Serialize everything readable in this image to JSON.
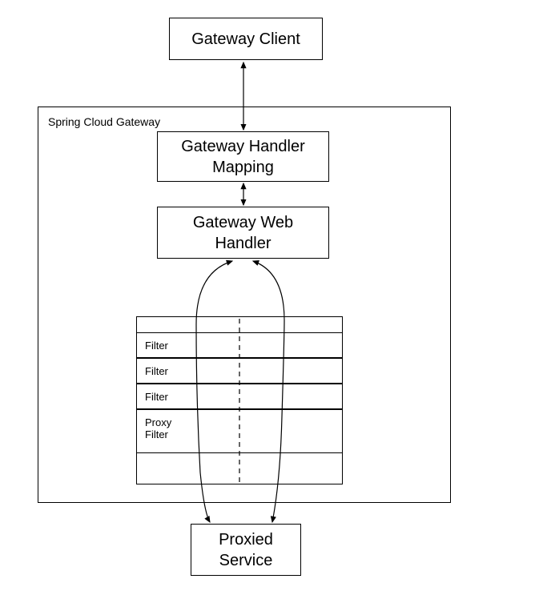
{
  "gatewayClient": "Gateway Client",
  "container": {
    "label": "Spring Cloud Gateway"
  },
  "handlerMapping": {
    "line1": "Gateway Handler",
    "line2": "Mapping"
  },
  "webHandler": {
    "line1": "Gateway Web",
    "line2": "Handler"
  },
  "filters": {
    "f1": "Filter",
    "f2": "Filter",
    "f3": "Filter",
    "proxy1": "Proxy",
    "proxy2": "Filter"
  },
  "proxiedService": {
    "line1": "Proxied",
    "line2": "Service"
  }
}
